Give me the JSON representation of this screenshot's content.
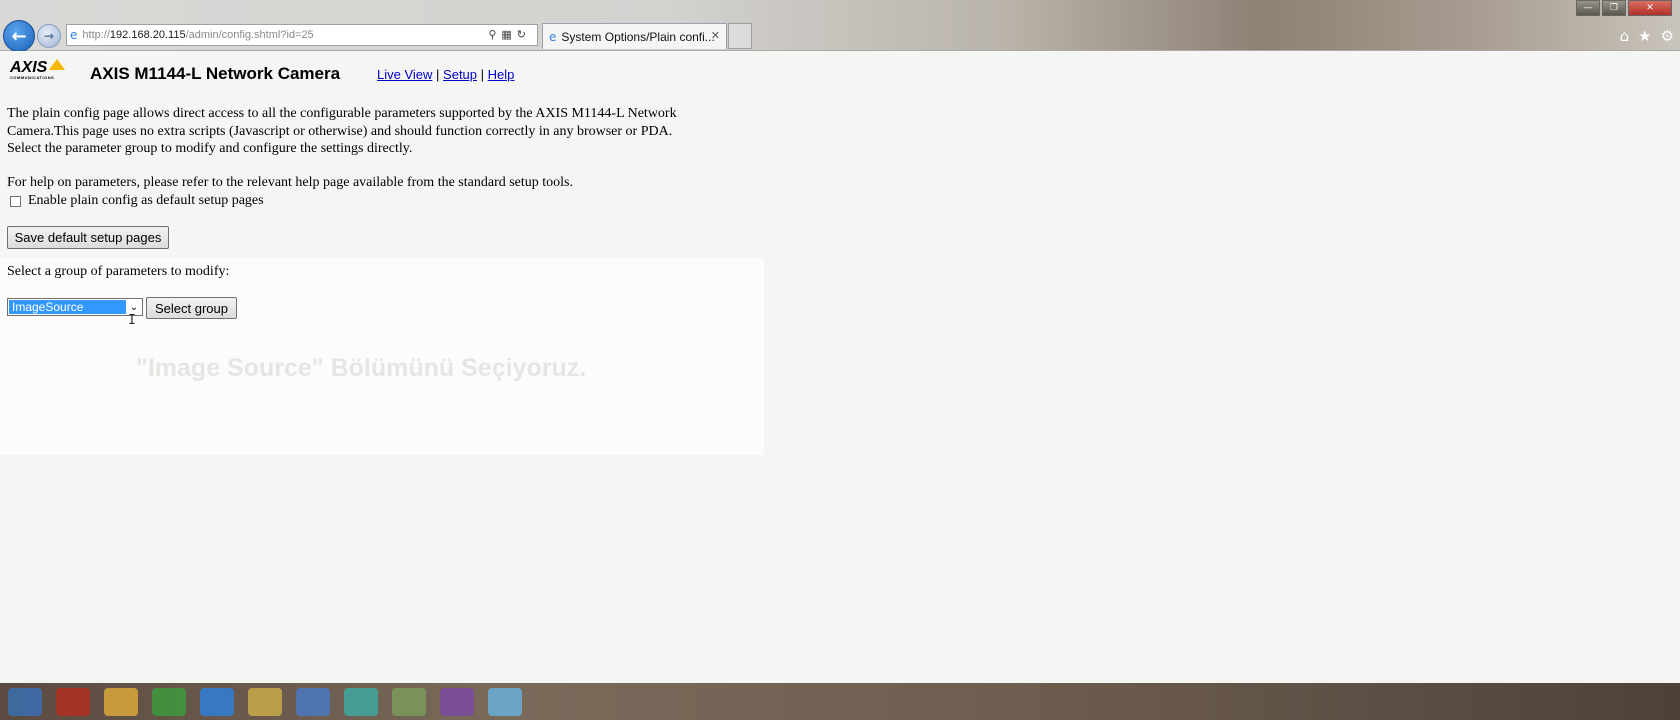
{
  "browser": {
    "address_prefix": "http://",
    "address_host": "192.168.20.115",
    "address_path": "/admin/config.shtml?id=25",
    "tab_title": "System Options/Plain confi...",
    "icons": [
      "back-icon",
      "forward-icon",
      "search-icon",
      "refresh-icon",
      "home-icon",
      "star-icon",
      "gear-icon",
      "minimize-icon",
      "restore-icon",
      "close-icon"
    ]
  },
  "header": {
    "logo_text": "AXIS",
    "logo_sub": "COMMUNICATIONS",
    "title": "AXIS M1144-L Network Camera",
    "nav": {
      "live_view": "Live View",
      "sep1": "|",
      "setup": "Setup",
      "sep2": "|",
      "help": "Help"
    }
  },
  "content": {
    "intro_line1": "The plain config page allows direct access to all the configurable parameters supported by the AXIS M1144-L Network",
    "intro_line2": "Camera.This page uses no extra scripts (Javascript or otherwise) and should function correctly in any browser or PDA.",
    "intro_line3": "Select the parameter group to modify and configure the settings directly.",
    "help_text": "For help on parameters, please refer to the relevant help page available from the standard setup tools.",
    "checkbox_label": "Enable plain config as default setup pages",
    "checkbox_checked": false,
    "save_button": "Save default setup pages",
    "group_label": "Select a group of parameters to modify:",
    "group_selected": "ImageSource",
    "select_button": "Select group",
    "caption": "\"Image Source\" Bölümünü Seçiyoruz."
  }
}
